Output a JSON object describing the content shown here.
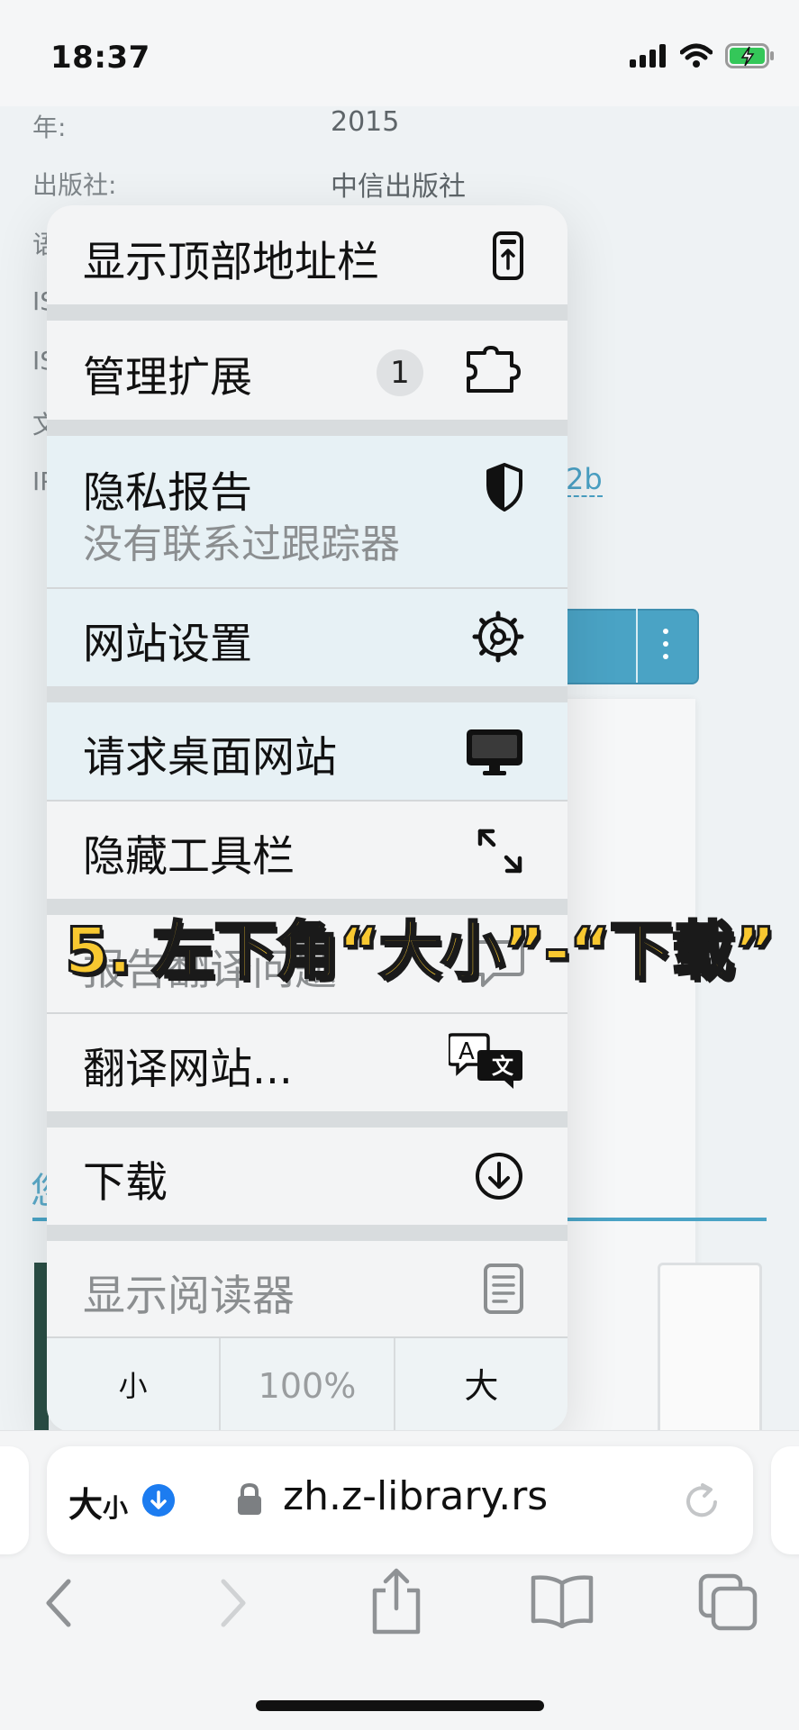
{
  "status": {
    "time": "18:37"
  },
  "background": {
    "rows": [
      {
        "label": "年:",
        "value": "2015"
      },
      {
        "label": "出版社:",
        "value": "中信出版社"
      },
      {
        "label": "语",
        "value": ""
      },
      {
        "label": "IS",
        "value": ""
      },
      {
        "label": "IS",
        "value": ""
      },
      {
        "label": "文",
        "value": ""
      },
      {
        "label": "IP",
        "value": ""
      }
    ],
    "link_fragment": "2b",
    "tab_char": "您"
  },
  "menu": {
    "items": [
      {
        "label": "显示顶部地址栏",
        "icon": "address-bar-top-icon"
      },
      {
        "label": "管理扩展",
        "badge": "1",
        "icon": "puzzle-extension-icon"
      },
      {
        "label": "隐私报告",
        "sublabel": "没有联系过跟踪器",
        "icon": "privacy-shield-icon"
      },
      {
        "label": "网站设置",
        "icon": "gear-icon"
      },
      {
        "label": "请求桌面网站",
        "icon": "desktop-monitor-icon"
      },
      {
        "label": "隐藏工具栏",
        "icon": "expand-arrows-icon"
      },
      {
        "label": "报告翻译问题",
        "icon": "speech-bubble-icon"
      },
      {
        "label": "翻译网站...",
        "icon": "translate-icon"
      },
      {
        "label": "下载",
        "icon": "download-circle-icon"
      },
      {
        "label": "显示阅读器",
        "icon": "reader-doc-icon"
      }
    ],
    "zoom": {
      "smaller": "小",
      "level": "100%",
      "larger": "大"
    }
  },
  "caption": "5. 左下角“大小”-“下载”",
  "url_bar": {
    "aa_big": "大",
    "aa_small": "小",
    "url": "zh.z-library.rs"
  },
  "colors": {
    "accent": "#1c7cf0",
    "caption_yellow": "#f8c830",
    "site_teal": "#4aa3c5"
  }
}
